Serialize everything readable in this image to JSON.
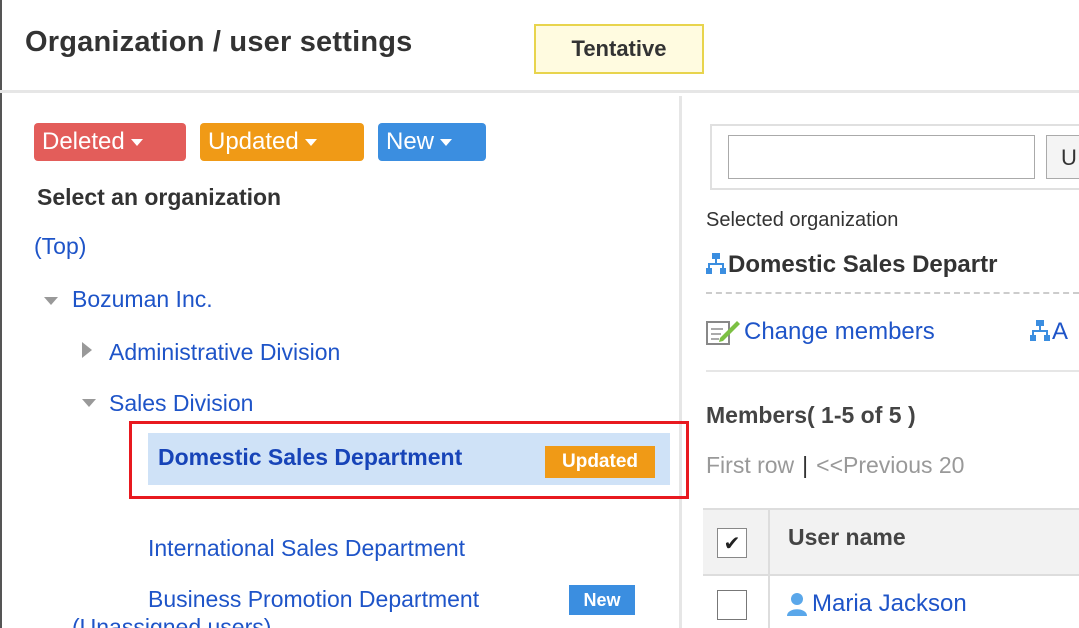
{
  "header": {
    "title": "Organization / user settings",
    "status_badge": "Tentative"
  },
  "filters": {
    "deleted_label": "Deleted",
    "updated_label": "Updated",
    "new_label": "New",
    "colors": {
      "deleted": "#e35d5a",
      "updated": "#f09a16",
      "new": "#3b8ee0"
    }
  },
  "tree": {
    "heading": "Select an organization",
    "top_label": "(Top)",
    "root": "Bozuman Inc.",
    "admin_division": "Administrative Division",
    "sales_division": "Sales Division",
    "selected_item": "Domestic Sales Department",
    "selected_badge": "Updated",
    "international": "International Sales Department",
    "business_promotion": "Business Promotion Department",
    "business_badge": "New",
    "unassigned": "(Unassigned users)"
  },
  "right": {
    "search_button_label": "U",
    "selected_caption": "Selected organization",
    "selected_name": "Domestic Sales Departr",
    "change_members": "Change members",
    "next_action_partial": "A",
    "members_title": "Members( 1-5 of 5 )",
    "pager_first": "First row",
    "pager_sep": "|",
    "pager_prev": "<<Previous 20",
    "check_mark": "✔",
    "column_user_name": "User name",
    "first_user": "Maria Jackson"
  }
}
